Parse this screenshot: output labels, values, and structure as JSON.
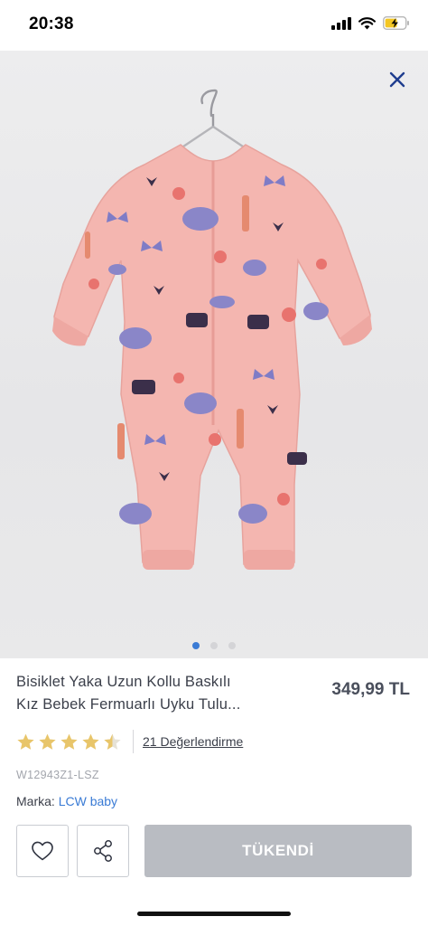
{
  "status_bar": {
    "time": "20:38"
  },
  "product": {
    "title_line1": "Bisiklet Yaka Uzun Kollu Baskılı",
    "title_line2": "Kız Bebek Fermuarlı Uyku Tulu...",
    "price": "349,99 TL",
    "rating": 4.5,
    "rating_max": 5,
    "reviews_label": "21 Değerlendirme",
    "sku": "W12943Z1-LSZ",
    "brand_label": "Marka:",
    "brand_name": "LCW baby"
  },
  "gallery": {
    "current_index": 1,
    "total": 3
  },
  "actions": {
    "soldout_label": "TÜKENDİ"
  },
  "colors": {
    "accent": "#3a7bd5",
    "star": "#e8c56a",
    "soldout_bg": "#b9bcc2",
    "garment": "#f3b6b1"
  },
  "icons": [
    "signal-icon",
    "wifi-icon",
    "battery-charging-icon",
    "close-icon",
    "heart-icon",
    "share-icon",
    "star-icon"
  ]
}
